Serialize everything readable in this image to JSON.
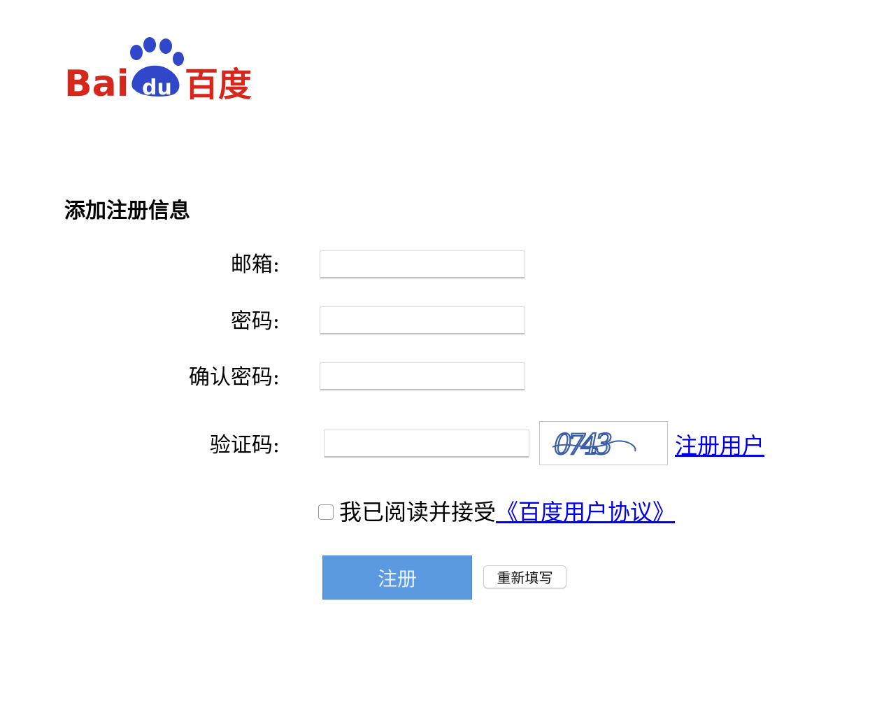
{
  "logo": {
    "text_latin": "Bai",
    "text_badge": "du",
    "text_cn": "百度",
    "colors": {
      "red": "#d7261c",
      "blue": "#2f47c8"
    }
  },
  "form": {
    "title": "添加注册信息",
    "email_label": "邮箱:",
    "email_value": "",
    "password_label": "密码:",
    "password_value": "",
    "confirm_label": "确认密码:",
    "confirm_value": "",
    "captcha_label": "验证码:",
    "captcha_value": "",
    "captcha_text": "0743",
    "register_link": "注册用户",
    "agree_text": "我已阅读并接受",
    "agree_link": "《百度用户协议》",
    "agree_checked": false,
    "submit_label": "注册",
    "reset_label": "重新填写"
  },
  "colors": {
    "link": "#0000ee",
    "submit_bg": "#5b9ae0",
    "captcha_ink": "#3a5fa8"
  }
}
